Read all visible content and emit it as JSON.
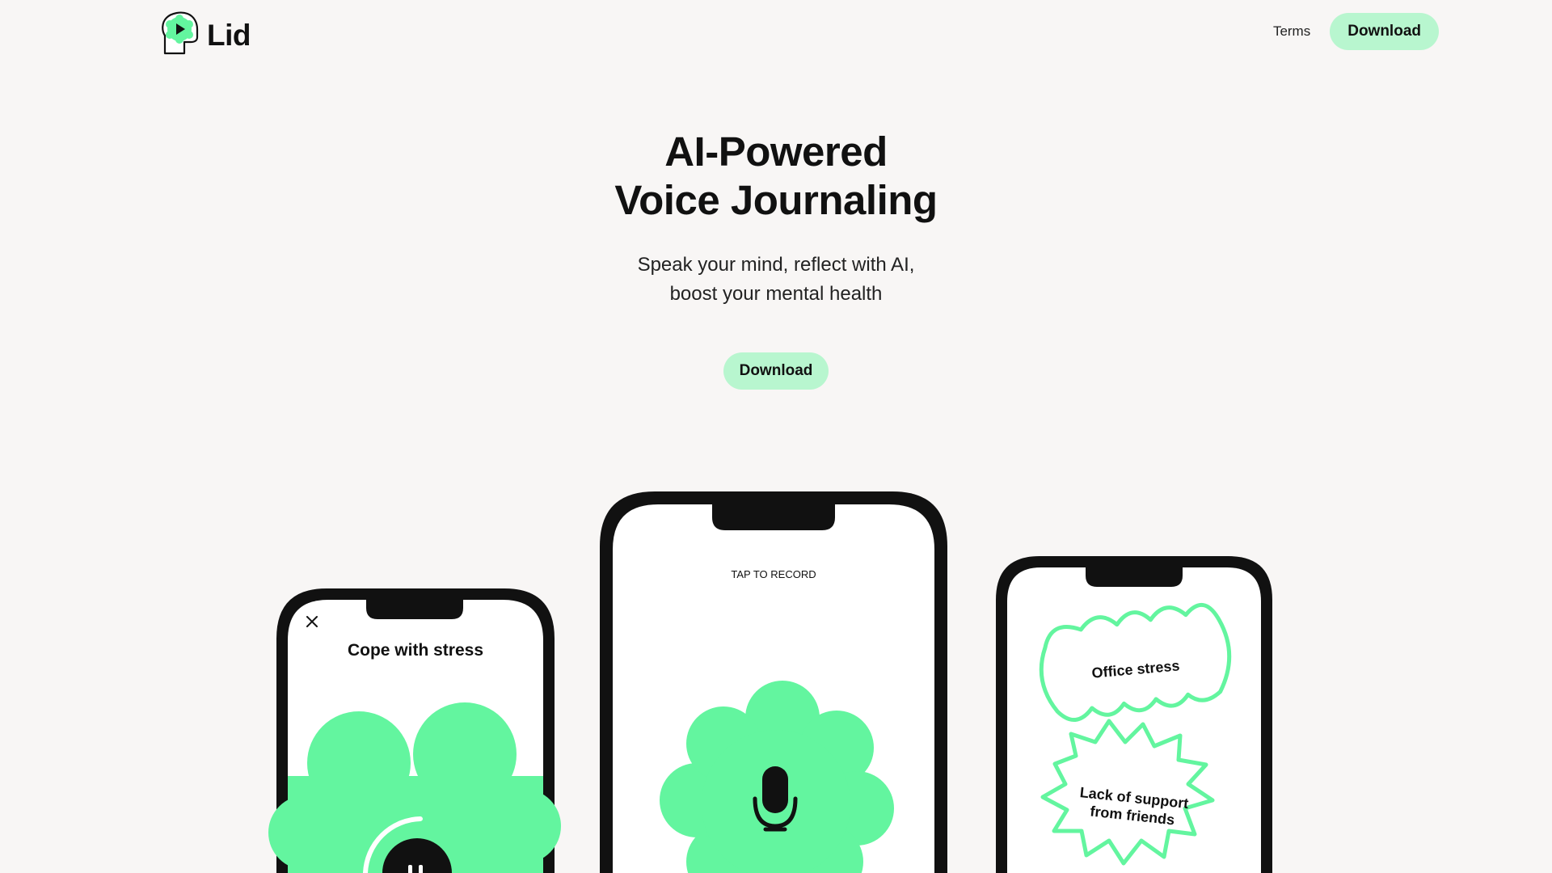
{
  "brand": {
    "name": "Lid",
    "logo_icon": "play-head-icon",
    "accent": "#63f59f",
    "pill_bg": "#b8f6cf"
  },
  "nav": {
    "terms_label": "Terms",
    "download_label": "Download"
  },
  "hero": {
    "title_line1": "AI-Powered",
    "title_line2": "Voice Journaling",
    "subtitle_line1": "Speak your mind, reflect with AI,",
    "subtitle_line2": "boost your mental health",
    "cta_label": "Download"
  },
  "phones": {
    "left": {
      "close_icon": "close-icon",
      "title": "Cope with stress",
      "pause_icon": "pause-icon"
    },
    "center": {
      "hint": "TAP TO RECORD",
      "mic_icon": "microphone-icon"
    },
    "right": {
      "tag1": "Office stress",
      "tag2_line1": "Lack of support",
      "tag2_line2": "from friends"
    }
  }
}
